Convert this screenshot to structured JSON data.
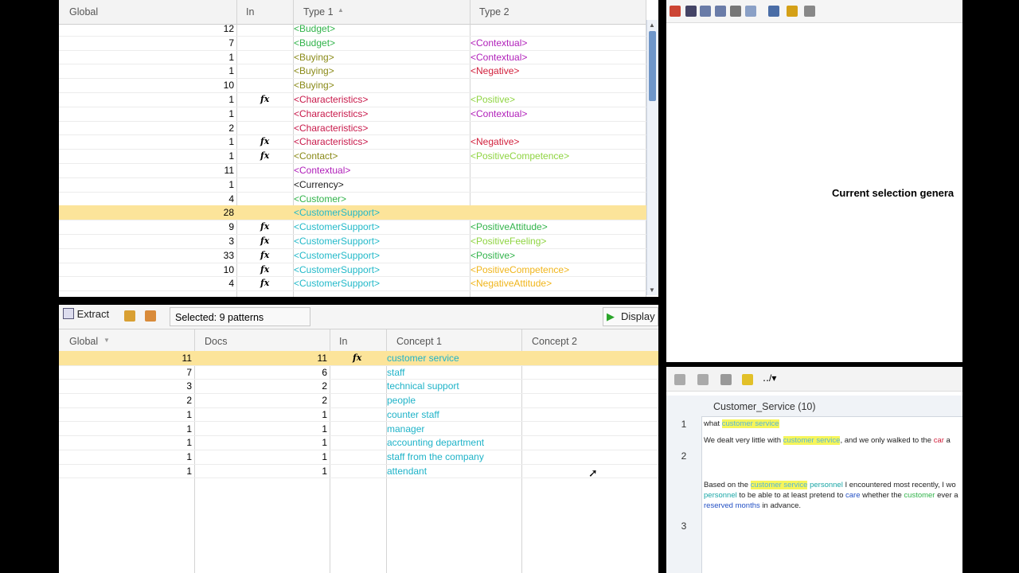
{
  "upper_table": {
    "headers": [
      "Global",
      "In",
      "Type 1",
      "Type 2"
    ],
    "rows": [
      {
        "global": "12",
        "fx": "",
        "type1": "<Budget>",
        "c1": "c-green",
        "type2": "",
        "c2": ""
      },
      {
        "global": "7",
        "fx": "",
        "type1": "<Budget>",
        "c1": "c-green",
        "type2": "<Contextual>",
        "c2": "c-purple"
      },
      {
        "global": "1",
        "fx": "",
        "type1": "<Buying>",
        "c1": "c-olive",
        "type2": "<Contextual>",
        "c2": "c-purple"
      },
      {
        "global": "1",
        "fx": "",
        "type1": "<Buying>",
        "c1": "c-olive",
        "type2": "<Negative>",
        "c2": "c-red"
      },
      {
        "global": "10",
        "fx": "",
        "type1": "<Buying>",
        "c1": "c-olive",
        "type2": "",
        "c2": ""
      },
      {
        "global": "1",
        "fx": "fx",
        "type1": "<Characteristics>",
        "c1": "c-crimson",
        "type2": "<Positive>",
        "c2": "c-lime"
      },
      {
        "global": "1",
        "fx": "",
        "type1": "<Characteristics>",
        "c1": "c-crimson",
        "type2": "<Contextual>",
        "c2": "c-purple"
      },
      {
        "global": "2",
        "fx": "",
        "type1": "<Characteristics>",
        "c1": "c-crimson",
        "type2": "",
        "c2": ""
      },
      {
        "global": "1",
        "fx": "fx",
        "type1": "<Characteristics>",
        "c1": "c-crimson",
        "type2": "<Negative>",
        "c2": "c-red"
      },
      {
        "global": "1",
        "fx": "fx",
        "type1": "<Contact>",
        "c1": "c-olive",
        "type2": "<PositiveCompetence>",
        "c2": "c-lime"
      },
      {
        "global": "11",
        "fx": "",
        "type1": "<Contextual>",
        "c1": "c-purple",
        "type2": "",
        "c2": ""
      },
      {
        "global": "1",
        "fx": "",
        "type1": "<Currency>",
        "c1": "c-black",
        "type2": "",
        "c2": ""
      },
      {
        "global": "4",
        "fx": "",
        "type1": "<Customer>",
        "c1": "c-green",
        "type2": "",
        "c2": ""
      },
      {
        "global": "28",
        "fx": "",
        "type1": "<CustomerSupport>",
        "c1": "c-cyan",
        "type2": "",
        "c2": "",
        "selected": true
      },
      {
        "global": "9",
        "fx": "fx",
        "type1": "<CustomerSupport>",
        "c1": "c-cyan",
        "type2": "<PositiveAttitude>",
        "c2": "c-green"
      },
      {
        "global": "3",
        "fx": "fx",
        "type1": "<CustomerSupport>",
        "c1": "c-cyan",
        "type2": "<PositiveFeeling>",
        "c2": "c-lime"
      },
      {
        "global": "33",
        "fx": "fx",
        "type1": "<CustomerSupport>",
        "c1": "c-cyan",
        "type2": "<Positive>",
        "c2": "c-green"
      },
      {
        "global": "10",
        "fx": "fx",
        "type1": "<CustomerSupport>",
        "c1": "c-cyan",
        "type2": "<PositiveCompetence>",
        "c2": "c-orange"
      },
      {
        "global": "4",
        "fx": "fx",
        "type1": "<CustomerSupport>",
        "c1": "c-cyan",
        "type2": "<NegativeAttitude>",
        "c2": "c-orange"
      }
    ]
  },
  "lower": {
    "extract_label": "Extract",
    "selected_label": "Selected: 9 patterns",
    "display_label": "Display",
    "headers": [
      "Global",
      "Docs",
      "In",
      "Concept 1",
      "Concept 2"
    ],
    "rows": [
      {
        "global": "11",
        "docs": "11",
        "fx": "fx",
        "concept1": "customer service",
        "selected": true
      },
      {
        "global": "7",
        "docs": "6",
        "fx": "",
        "concept1": "staff"
      },
      {
        "global": "3",
        "docs": "2",
        "fx": "",
        "concept1": "technical support"
      },
      {
        "global": "2",
        "docs": "2",
        "fx": "",
        "concept1": "people"
      },
      {
        "global": "1",
        "docs": "1",
        "fx": "",
        "concept1": "counter staff"
      },
      {
        "global": "1",
        "docs": "1",
        "fx": "",
        "concept1": "manager"
      },
      {
        "global": "1",
        "docs": "1",
        "fx": "",
        "concept1": "accounting department"
      },
      {
        "global": "1",
        "docs": "1",
        "fx": "",
        "concept1": "staff from the company"
      },
      {
        "global": "1",
        "docs": "1",
        "fx": "",
        "concept1": "attendant"
      }
    ]
  },
  "right": {
    "current_selection": "Current selection genera",
    "category_header": "Customer_Service (10)",
    "docs": [
      {
        "num": "1"
      },
      {
        "num": "2"
      },
      {
        "num": "3"
      }
    ],
    "doc1": {
      "a": "what ",
      "b": "customer service"
    },
    "doc2": {
      "a": "We dealt very little with ",
      "b": "customer service",
      ",c": "",
      "c": ", and we only walked to the ",
      "d": "car",
      "e": " a"
    },
    "doc3": {
      "line1a": "Based on the ",
      "line1b": "customer service",
      "line1c": " personnel",
      "line1d": " I encountered most recently, I wo",
      "line2a": "personnel",
      "line2b": " to be able to at least pretend to ",
      "line2c": "care",
      "line2d": " whether the ",
      "line2e": "customer",
      "line2f": " ever a",
      "line3a": "reserved",
      "line3b": " ",
      "line3c": "months",
      "line3d": " in advance."
    }
  }
}
